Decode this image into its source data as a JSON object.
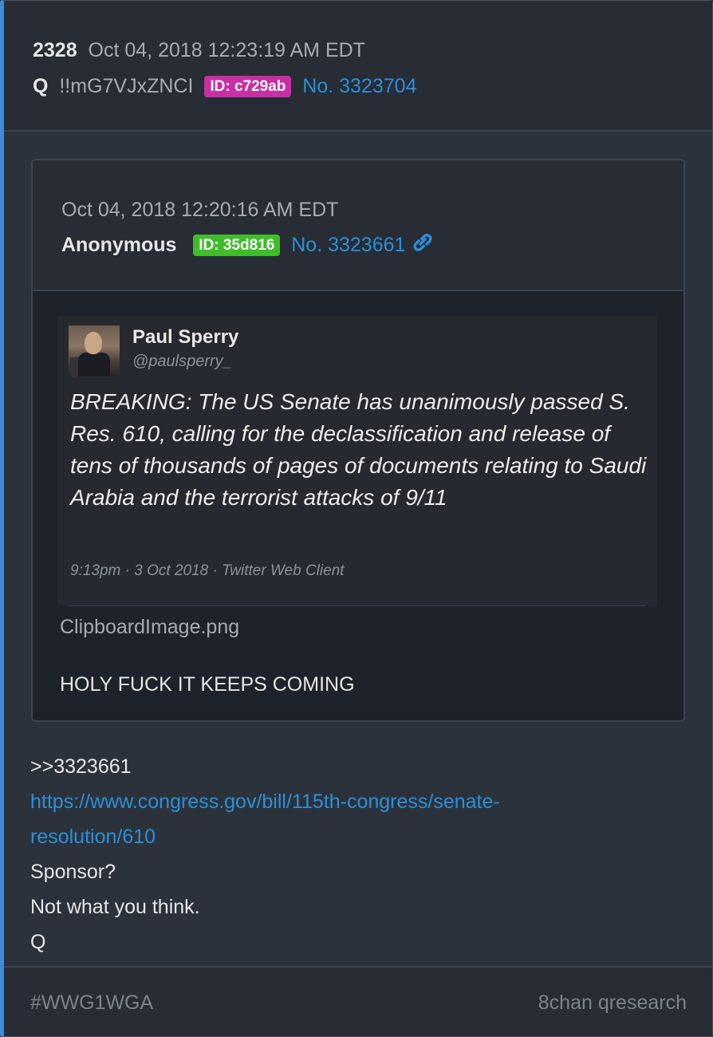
{
  "post": {
    "number": "2328",
    "timestamp": "Oct 04, 2018 12:23:19 AM EDT",
    "author": "Q",
    "tripcode": "!!mG7VJxZNCI",
    "id_badge": "ID: c729ab",
    "post_no": "No. 3323704",
    "colors": {
      "id_badge": "#c72fa3",
      "link": "#2b8fd6",
      "accent": "#3b8fd9"
    }
  },
  "quoted": {
    "timestamp": "Oct 04, 2018 12:20:16 AM EDT",
    "author": "Anonymous",
    "id_badge": "ID: 35d816",
    "post_no": "No. 3323661",
    "link_icon": "link-icon",
    "colors": {
      "id_badge": "#3fbd2b"
    },
    "image": {
      "filename": "ClipboardImage.png",
      "tweet": {
        "name": "Paul Sperry",
        "handle": "@paulsperry_",
        "text": "BREAKING: The US Senate has unanimously passed S. Res. 610, calling for the declassification and release of tens of thousands of pages of documents relating to Saudi Arabia and the terrorist attacks of 9/11",
        "meta": "9:13pm · 3 Oct 2018 · Twitter Web Client"
      }
    },
    "body": "HOLY FUCK IT KEEPS COMING"
  },
  "body": {
    "reply_ref": ">>3323661",
    "url": "https://www.congress.gov/bill/115th-congress/senate-resolution/610",
    "line1": "Sponsor?",
    "line2": "Not what you think.",
    "signature": "Q"
  },
  "footer": {
    "tag": "#WWG1WGA",
    "source": "8chan qresearch"
  }
}
